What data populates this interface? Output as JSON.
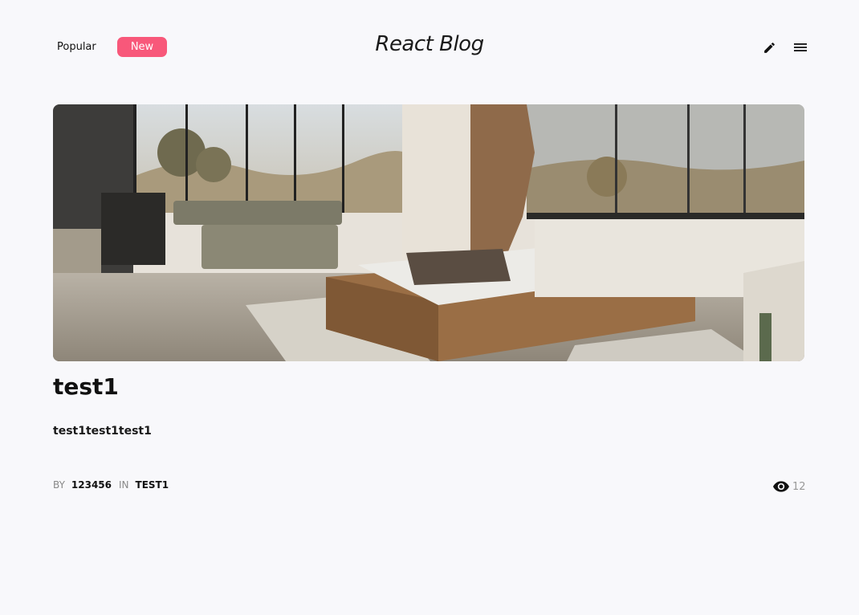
{
  "header": {
    "tabs": [
      {
        "label": "Popular",
        "active": false
      },
      {
        "label": "New",
        "active": true
      }
    ],
    "title": "React Blog",
    "accent_color": "#f8587a",
    "icons": [
      "pencil-icon",
      "menu-icon"
    ]
  },
  "post": {
    "image": "bedroom-living-room-photo",
    "title": "test1",
    "excerpt": "test1test1test1",
    "meta": {
      "by_label": "BY",
      "author": "123456",
      "in_label": "IN",
      "category": "TEST1"
    },
    "views": "12"
  }
}
